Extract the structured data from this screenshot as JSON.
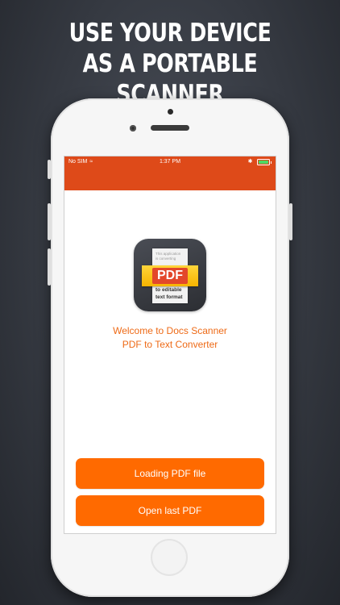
{
  "headline": {
    "line1": "USE YOUR DEVICE",
    "line2": "AS A PORTABLE SCANNER"
  },
  "status_bar": {
    "carrier": "No SIM",
    "wifi_icon": "≈",
    "time": "1:37 PM",
    "bluetooth_icon": "✱",
    "battery_level": 1.0
  },
  "app_icon": {
    "doc_lines": [
      "This application",
      "is converting",
      "",
      "",
      "to editable",
      "text format"
    ],
    "label": "PDF"
  },
  "welcome": {
    "line1": "Welcome to Docs Scanner",
    "line2": "PDF to Text Converter"
  },
  "buttons": {
    "load_label": "Loading PDF file",
    "open_label": "Open last PDF"
  },
  "colors": {
    "topbar": "#de4a19",
    "accent_text": "#ee6a16",
    "button": "#ff6a00"
  }
}
